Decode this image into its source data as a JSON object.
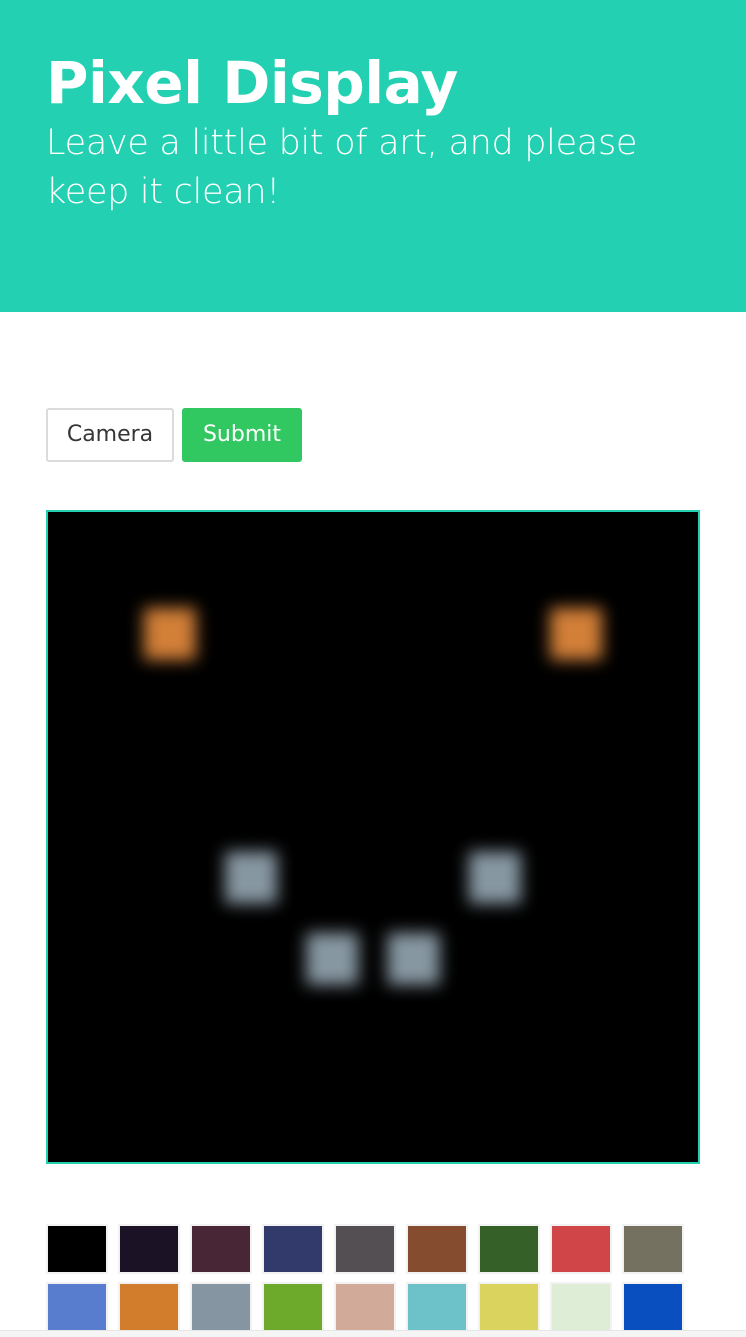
{
  "header": {
    "title": "Pixel Display",
    "subtitle": "Leave a little bit of art, and please keep it clean!",
    "background_color": "#23d1b2"
  },
  "toolbar": {
    "camera_label": "Camera",
    "submit_label": "Submit",
    "submit_color": "#32c861"
  },
  "pixel_canvas": {
    "grid_size": 8,
    "background_color": "#000000",
    "border_color": "#23d1b2",
    "pixels": [
      {
        "row": 1,
        "col": 1,
        "color": "#d27f38"
      },
      {
        "row": 1,
        "col": 6,
        "color": "#d27f38"
      },
      {
        "row": 4,
        "col": 2,
        "color": "#8797a2"
      },
      {
        "row": 4,
        "col": 5,
        "color": "#8797a2"
      },
      {
        "row": 5,
        "col": 3,
        "color": "#8797a2"
      },
      {
        "row": 5,
        "col": 4,
        "color": "#8797a2"
      }
    ]
  },
  "palette": {
    "colors": [
      "#000000",
      "#1b1226",
      "#492636",
      "#323a6c",
      "#534f52",
      "#854c30",
      "#356128",
      "#d04648",
      "#757161",
      "#597dce",
      "#d27d2c",
      "#8595a1",
      "#6daa2c",
      "#d2aa99",
      "#6dc2ca",
      "#dad45e",
      "#deeed6",
      "#0a4fbf"
    ]
  }
}
